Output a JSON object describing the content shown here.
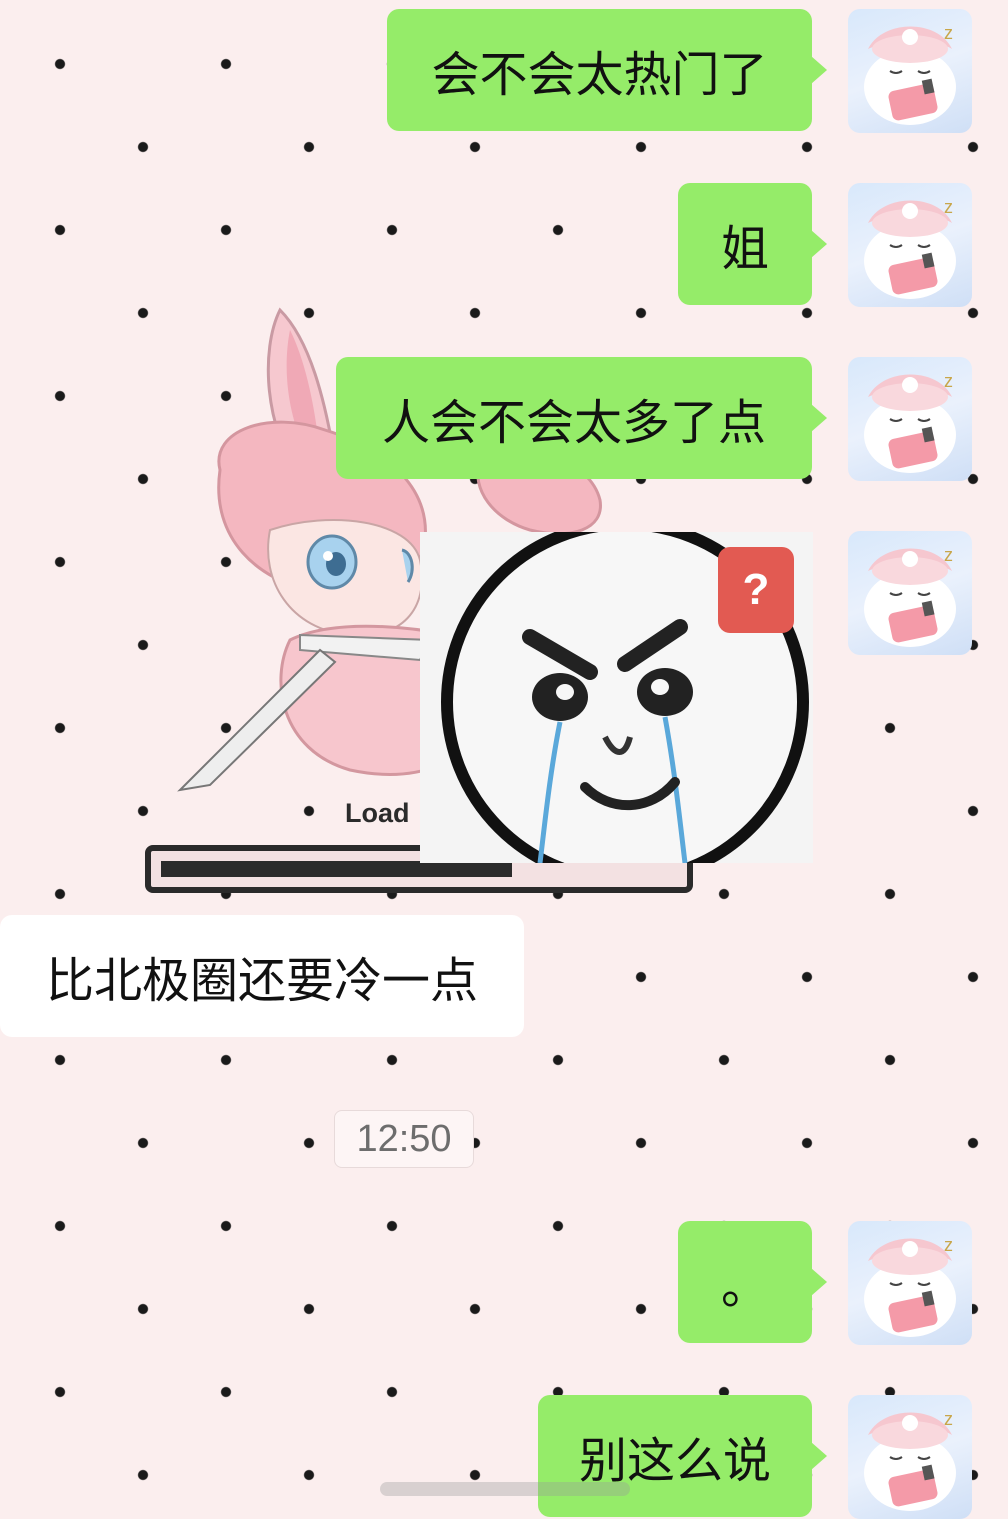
{
  "wallpaper": {
    "loading_text": "Load",
    "progress_percent": 68
  },
  "messages": [
    {
      "text": "会不会太热门了",
      "side": "out"
    },
    {
      "text": "姐",
      "side": "out"
    },
    {
      "text": "人会不会太多了点",
      "side": "out"
    },
    {
      "sticker": "crying-angry-face-sticker",
      "badge": "?",
      "side": "out"
    },
    {
      "text": "比北极圈还要冷一点",
      "side": "in"
    },
    {
      "text": "。",
      "side": "out"
    },
    {
      "text": "别这么说",
      "side": "out"
    }
  ],
  "timestamp": "12:50",
  "colors": {
    "outgoing_bubble": "#95ec69",
    "incoming_bubble": "#ffffff",
    "background": "#fbeeee",
    "badge": "#e25a52"
  }
}
